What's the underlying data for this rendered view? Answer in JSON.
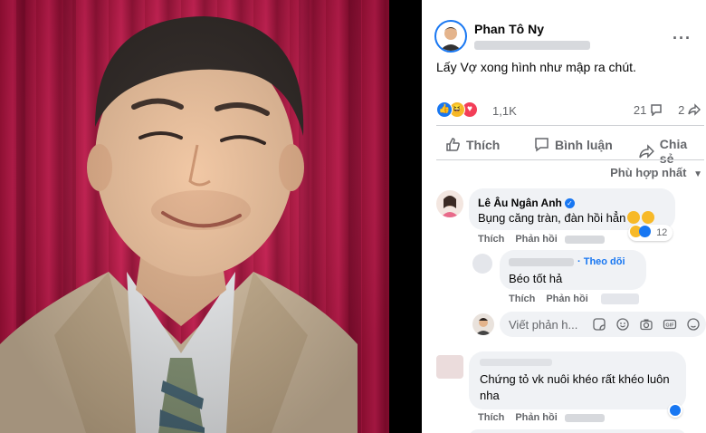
{
  "post": {
    "author": "Phan Tô Ny",
    "caption": "Lấy Vợ xong hình như mập ra chút.",
    "reactions_count": "1,1K",
    "comments_count": "21",
    "shares_count": "2",
    "reaction_types": [
      "like-icon",
      "haha-icon",
      "love-icon"
    ]
  },
  "actions": {
    "like": "Thích",
    "comment": "Bình luận",
    "share": "Chia sẻ"
  },
  "sort_label": "Phù hợp nhất",
  "comments": [
    {
      "name": "Lê Âu Ngân Anh",
      "text": "Bụng căng tràn, đàn hồi hẳn",
      "reaction_count": "12",
      "like_label": "Thích",
      "reply_label": "Phản hồi",
      "replies": [
        {
          "follow_label": "· Theo dõi",
          "text": "Béo tốt hả",
          "like_label": "Thích",
          "reply_label": "Phản hồi"
        }
      ]
    },
    {
      "text": "Chứng tỏ vk nuôi khéo rất khéo luôn nha",
      "like_label": "Thích",
      "reply_label": "Phản hồi"
    }
  ],
  "reply_box": {
    "placeholder": "Viết phản h..."
  },
  "colors": {
    "facebook_blue": "#1877f2",
    "curtain_red": "#c91a4d",
    "suit_beige": "#d9c3a5"
  }
}
